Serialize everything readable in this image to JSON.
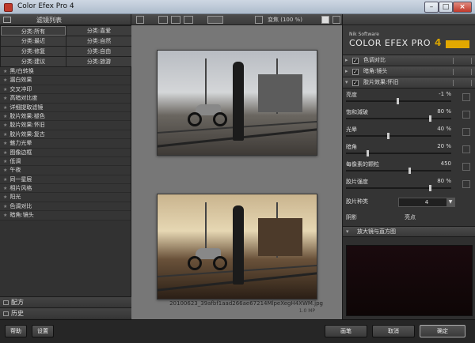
{
  "window": {
    "title": "Color Efex Pro 4",
    "min_label": "–",
    "max_label": "□",
    "close_label": "×"
  },
  "left_panel": {
    "header": "滤镜列表",
    "categories": [
      "分类:所有",
      "分类:喜爱",
      "分类:最近",
      "分类:自然",
      "分类:修复",
      "分类:自由",
      "分类:建议",
      "分类:旅游"
    ],
    "filters": [
      "黑/白转换",
      "漏白效果",
      "交叉冲印",
      "高暗对比度",
      "详细提取滤镜",
      "胶片效果:褪色",
      "胶片效果:怀旧",
      "胶片效果:复古",
      "魅力光晕",
      "图像边框",
      "低调",
      "午夜",
      "同一星层",
      "相片风格",
      "阳光",
      "色调对比",
      "暗角:镜头"
    ],
    "bottom": [
      "配方",
      "历史"
    ],
    "star": "★"
  },
  "center": {
    "zoom_label": "变焦 (100 %)",
    "filename": "20100623_39afbf1aad266ae67214MlpeXegH4XWM.jpg",
    "filesize": "1.0 MP"
  },
  "right_panel": {
    "brand_small": "Nik Software",
    "brand_name": "COLOR EFEX PRO",
    "brand_ver": "4",
    "filters": [
      {
        "name": "色调对比",
        "checked": "✓"
      },
      {
        "name": "暗角:镜头",
        "checked": "✓"
      },
      {
        "name": "胶片效果:怀旧",
        "checked": "✓"
      }
    ],
    "params": [
      {
        "name": "亮度",
        "value": "-1 %",
        "frac": 0.49
      },
      {
        "name": "饱和減破",
        "value": "80 %",
        "frac": 0.8
      },
      {
        "name": "光晕",
        "value": "40 %",
        "frac": 0.4
      },
      {
        "name": "暗角",
        "value": "20 %",
        "frac": 0.2
      },
      {
        "name": "每像素的颗粒",
        "value": "450",
        "frac": 0.6
      },
      {
        "name": "胶片强度",
        "value": "80 %",
        "frac": 0.8
      }
    ],
    "film_type_label": "胶片种类",
    "film_type_value": "4",
    "levels_shadow": "阴影",
    "levels_highlight": "亮点",
    "loupe_label": "放大镜与直方图"
  },
  "footer": {
    "help": "帮助",
    "settings": "设置",
    "brush": "画笔",
    "cancel": "取消",
    "ok": "确定"
  }
}
